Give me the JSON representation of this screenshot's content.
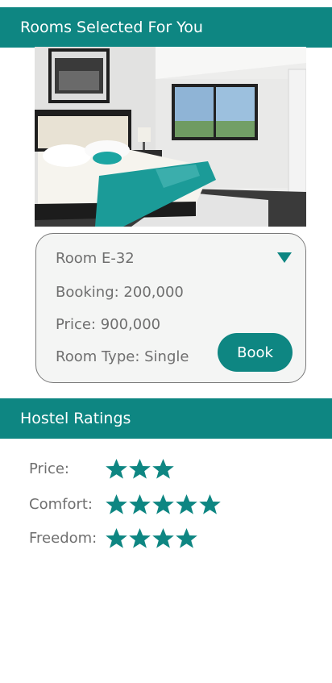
{
  "rooms_section": {
    "title": "Rooms Selected For You"
  },
  "room": {
    "name": "Room E-32",
    "booking": "Booking: 200,000",
    "price": "Price: 900,000",
    "room_type": "Room Type: Single",
    "book_label": "Book"
  },
  "ratings_section": {
    "title": "Hostel Ratings",
    "items": [
      {
        "label": "Price:",
        "stars": 3
      },
      {
        "label": "Comfort:",
        "stars": 5
      },
      {
        "label": "Freedom:",
        "stars": 4
      }
    ]
  },
  "colors": {
    "accent": "#0e8682",
    "text": "#6f6f6f",
    "card_bg": "#f4f5f4"
  }
}
